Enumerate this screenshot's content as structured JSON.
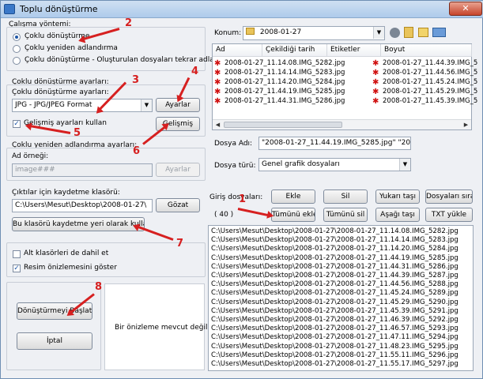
{
  "window": {
    "title": "Toplu dönüştürme",
    "close": "✕"
  },
  "method": {
    "heading": "Çalışma yöntemi:",
    "options": [
      "Çoklu dönüştürme",
      "Çoklu yeniden adlandırma",
      "Çoklu dönüştürme - Oluşturulan dosyaları tekrar adlandırma"
    ],
    "selected_index": 0
  },
  "convert": {
    "heading": "Çoklu dönüştürme ayarları:",
    "sublabel": "Çoklu dönüştürme ayarları:",
    "format": "JPG - JPG/JPEG Format",
    "settings_button": "Ayarlar",
    "advanced_check": "Gelişmiş ayarları kullan",
    "advanced_checked": true,
    "advanced_button": "Gelişmiş"
  },
  "rename": {
    "heading": "Çoklu yeniden adlandırma ayarları:",
    "example_label": "Ad örneği:",
    "example_value": "image###",
    "settings_button": "Ayarlar"
  },
  "output": {
    "heading": "Çıktılar için kaydetme klasörü:",
    "path": "C:\\Users\\Mesut\\Desktop\\2008-01-27\\",
    "browse": "Gözat",
    "use_as_output": "Bu klasörü kaydetme yeri olarak kullan"
  },
  "options": {
    "subfolders": "Alt klasörleri de dahil et",
    "subfolders_checked": false,
    "preview": "Resim önizlemesini göster",
    "preview_checked": true
  },
  "actions": {
    "start": "Dönüştürmeyi Başlat",
    "cancel": "İptal"
  },
  "preview_text": "Bir önizleme mevcut değil !",
  "browser": {
    "location_label": "Konum:",
    "location": "2008-01-27",
    "columns": [
      "Ad",
      "Çekildiği tarih",
      "Etiketler",
      "Boyut"
    ],
    "files_left": [
      "2008-01-27_11.14.08.IMG_5282.jpg",
      "2008-01-27_11.14.14.IMG_5283.jpg",
      "2008-01-27_11.14.20.IMG_5284.jpg",
      "2008-01-27_11.44.19.IMG_5285.jpg",
      "2008-01-27_11.44.31.IMG_5286.jpg"
    ],
    "files_right": [
      "2008-01-27_11.44.39.IMG_5",
      "2008-01-27_11.44.56.IMG_5",
      "2008-01-27_11.45.24.IMG_5",
      "2008-01-27_11.45.29.IMG_5",
      "2008-01-27_11.45.39.IMG_5"
    ],
    "filename_label": "Dosya Adı:",
    "filename_value": "\"2008-01-27_11.44.19.IMG_5285.jpg\" \"2008-01",
    "filetype_label": "Dosya türü:",
    "filetype_value": "Genel grafik dosyaları"
  },
  "inputs": {
    "label": "Giriş dosyaları:",
    "count": "( 40 )",
    "buttons": {
      "add": "Ekle",
      "delete": "Sil",
      "up": "Yukarı taşı",
      "sort": "Dosyaları sırala",
      "add_all": "Tümünü ekle",
      "delete_all": "Tümünü sil",
      "down": "Aşağı taşı",
      "load_txt": "TXT yükle"
    },
    "paths": [
      "C:\\Users\\Mesut\\Desktop\\2008-01-27\\2008-01-27_11.14.08.IMG_5282.jpg",
      "C:\\Users\\Mesut\\Desktop\\2008-01-27\\2008-01-27_11.14.14.IMG_5283.jpg",
      "C:\\Users\\Mesut\\Desktop\\2008-01-27\\2008-01-27_11.14.20.IMG_5284.jpg",
      "C:\\Users\\Mesut\\Desktop\\2008-01-27\\2008-01-27_11.44.19.IMG_5285.jpg",
      "C:\\Users\\Mesut\\Desktop\\2008-01-27\\2008-01-27_11.44.31.IMG_5286.jpg",
      "C:\\Users\\Mesut\\Desktop\\2008-01-27\\2008-01-27_11.44.39.IMG_5287.jpg",
      "C:\\Users\\Mesut\\Desktop\\2008-01-27\\2008-01-27_11.44.56.IMG_5288.jpg",
      "C:\\Users\\Mesut\\Desktop\\2008-01-27\\2008-01-27_11.45.24.IMG_5289.jpg",
      "C:\\Users\\Mesut\\Desktop\\2008-01-27\\2008-01-27_11.45.29.IMG_5290.jpg",
      "C:\\Users\\Mesut\\Desktop\\2008-01-27\\2008-01-27_11.45.39.IMG_5291.jpg",
      "C:\\Users\\Mesut\\Desktop\\2008-01-27\\2008-01-27_11.46.39.IMG_5292.jpg",
      "C:\\Users\\Mesut\\Desktop\\2008-01-27\\2008-01-27_11.46.57.IMG_5293.jpg",
      "C:\\Users\\Mesut\\Desktop\\2008-01-27\\2008-01-27_11.47.11.IMG_5294.jpg",
      "C:\\Users\\Mesut\\Desktop\\2008-01-27\\2008-01-27_11.48.23.IMG_5295.jpg",
      "C:\\Users\\Mesut\\Desktop\\2008-01-27\\2008-01-27_11.55.11.IMG_5296.jpg",
      "C:\\Users\\Mesut\\Desktop\\2008-01-27\\2008-01-27_11.55.17.IMG_5297.jpg"
    ]
  },
  "annotations": [
    "1",
    "2",
    "3",
    "4",
    "5",
    "6",
    "7",
    "8"
  ],
  "colors": {
    "accent": "#d62020",
    "titlebar": "#bcd4ee"
  }
}
